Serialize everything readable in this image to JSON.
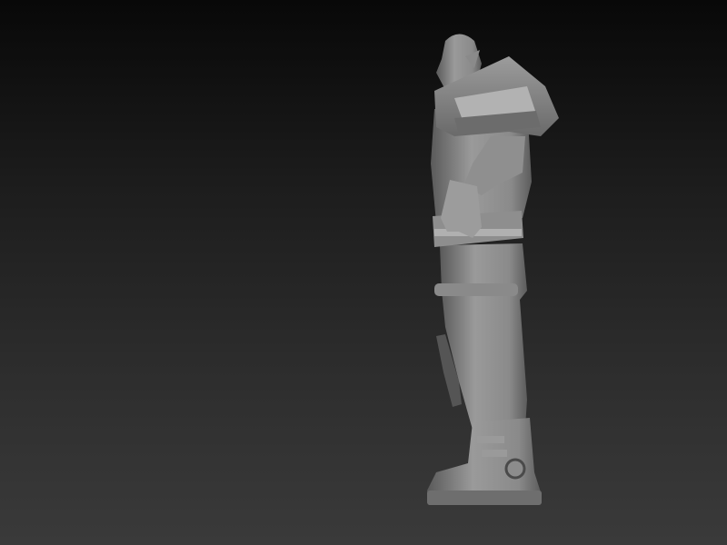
{
  "scene": {
    "subject": "sculpted-character-model",
    "colors": {
      "background_top": "#080808",
      "background_bottom": "#3a3a3a",
      "model_base": "#7a7a7a",
      "model_light": "#a8a8a8",
      "model_shadow": "#4a4a4a"
    }
  }
}
